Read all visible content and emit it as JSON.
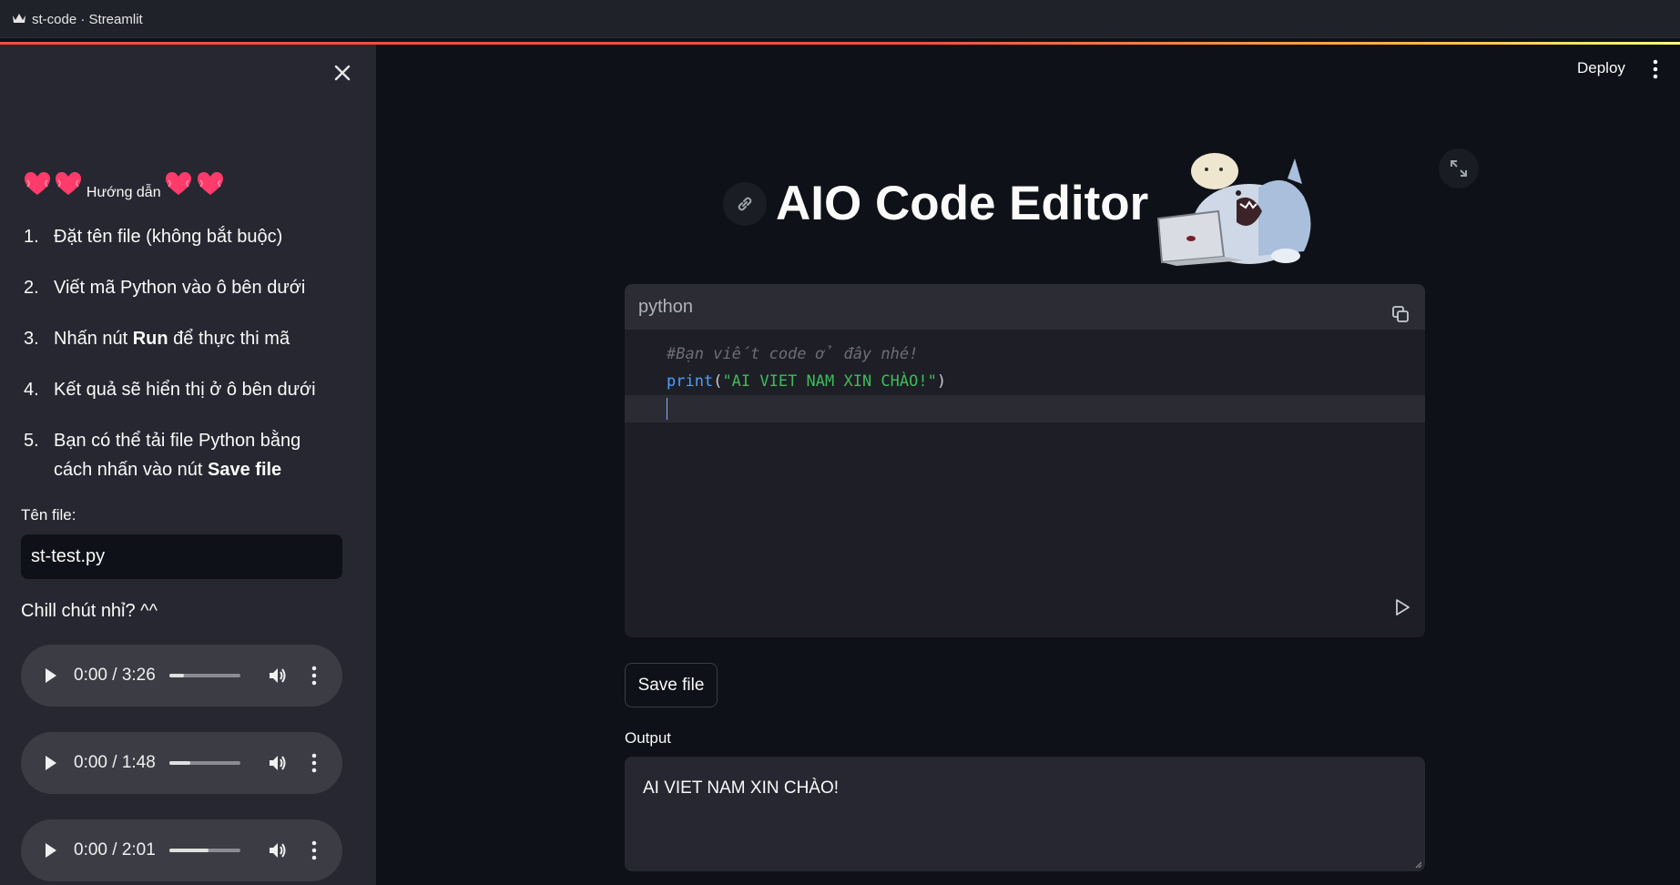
{
  "browser": {
    "tab_title": "st-code · Streamlit"
  },
  "sidebar": {
    "heading": "Hướng dẫn",
    "steps": [
      {
        "num": "1.",
        "text": "Đặt tên file (không bắt buộc)"
      },
      {
        "num": "2.",
        "text": "Viết mã Python vào ô bên dưới"
      },
      {
        "num": "3.",
        "pre": "Nhấn nút ",
        "bold": "Run",
        "post": " để thực thi mã"
      },
      {
        "num": "4.",
        "text": "Kết quả sẽ hiển thị ở ô bên dưới"
      },
      {
        "num": "5.",
        "pre": "Bạn có thể tải file Python bằng cách nhấn vào nút ",
        "bold": "Save file",
        "post": ""
      }
    ],
    "file_label": "Tên file:",
    "file_value": "st-test.py",
    "chill_text": "Chill chút nhỉ? ^^",
    "audio": [
      {
        "time": "0:00 / 3:26",
        "volume": 0.2
      },
      {
        "time": "0:00 / 1:48",
        "volume": 0.3
      },
      {
        "time": "0:00 / 2:01",
        "volume": 0.55
      }
    ]
  },
  "header": {
    "deploy_label": "Deploy"
  },
  "main": {
    "title": "AIO Code Editor",
    "editor": {
      "language": "python",
      "comment_line": "#Bạn viết code ở đây nhé!",
      "code_fn": "print",
      "code_open": "(",
      "code_string": "\"AI VIET NAM XIN CHÀO!\"",
      "code_close": ")"
    },
    "save_label": "Save file",
    "output_label": "Output",
    "output_text": "AI VIET NAM XIN CHÀO!"
  },
  "colors": {
    "accent": "#ff4b4b",
    "heart": "#ff3b6b",
    "code_fn": "#4da0ff",
    "code_string": "#3dbb5a"
  }
}
